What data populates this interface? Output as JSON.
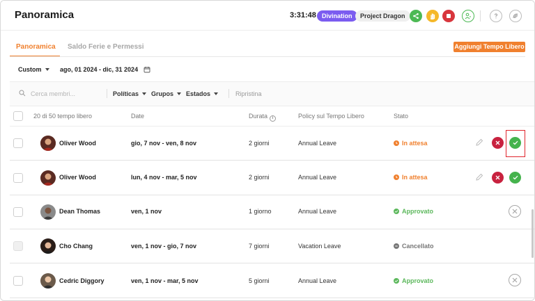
{
  "header": {
    "title": "Panoramica",
    "timer": "3:31:48",
    "badges": [
      "Divination",
      "Project Dragon"
    ],
    "icons": [
      "share-icon",
      "hand-icon",
      "stop-icon",
      "user-clock-icon",
      "help-icon",
      "settings-icon"
    ]
  },
  "tabs": [
    {
      "label": "Panoramica",
      "active": true
    },
    {
      "label": "Saldo Ferie e Permessi",
      "active": false
    }
  ],
  "add_button": "Aggiungi Tempo Libero",
  "period": {
    "selector": "Custom",
    "range": "ago, 01 2024 - dic, 31 2024"
  },
  "filters": {
    "search_placeholder": "Cerca membri...",
    "items": [
      "Políticas",
      "Grupos",
      "Estados"
    ],
    "reset": "Ripristina"
  },
  "table": {
    "count_label": "20 di 50 tempo libero",
    "columns": [
      "Date",
      "Durata",
      "Policy sul Tempo Libero",
      "Stato"
    ],
    "rows": [
      {
        "name": "Oliver Wood",
        "date": "gio, 7 nov - ven, 8 nov",
        "duration": "2 giorni",
        "policy": "Annual Leave",
        "status": "In attesa",
        "status_type": "pending",
        "actions": [
          "edit",
          "reject",
          "approve"
        ],
        "highlighted": true
      },
      {
        "name": "Oliver Wood",
        "date": "lun, 4 nov - mar, 5 nov",
        "duration": "2 giorni",
        "policy": "Annual Leave",
        "status": "In attesa",
        "status_type": "pending",
        "actions": [
          "edit",
          "reject",
          "approve"
        ],
        "highlighted": false
      },
      {
        "name": "Dean Thomas",
        "date": "ven, 1 nov",
        "duration": "1 giorno",
        "policy": "Annual Leave",
        "status": "Approvato",
        "status_type": "approved",
        "actions": [
          "cancel"
        ],
        "highlighted": false
      },
      {
        "name": "Cho Chang",
        "date": "ven, 1 nov - gio, 7 nov",
        "duration": "7 giorni",
        "policy": "Vacation Leave",
        "status": "Cancellato",
        "status_type": "cancelled",
        "actions": [],
        "highlighted": false
      },
      {
        "name": "Cedric Diggory",
        "date": "ven, 1 nov - mar, 5 nov",
        "duration": "5 giorni",
        "policy": "Annual Leave",
        "status": "Approvato",
        "status_type": "approved",
        "actions": [
          "cancel"
        ],
        "highlighted": false
      }
    ]
  },
  "colors": {
    "accent": "#f0802e",
    "badge_purple": "#7b5cf0",
    "pending": "#f0802e",
    "approved": "#5cb85c",
    "cancelled": "#777777",
    "reject": "#c8223f",
    "approve": "#45b34d"
  }
}
